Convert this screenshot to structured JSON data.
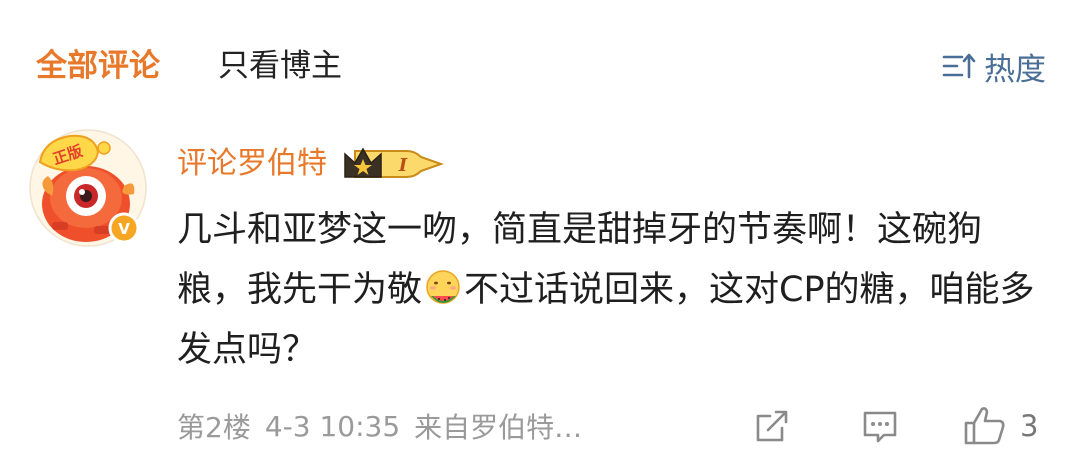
{
  "tabs": {
    "all_comments": "全部评论",
    "only_blogger": "只看博主"
  },
  "sort": {
    "label": "热度",
    "icon": "sort-icon"
  },
  "comment": {
    "author": "评论罗伯特",
    "badge": {
      "level": "I",
      "icon": "crown-icon"
    },
    "avatar": {
      "verified_mark": "V",
      "sticker_text": "正版"
    },
    "text_parts": [
      "几斗和亚梦这一吻，简直是甜掉牙的节奏啊！这碗狗粮，我先干为敬",
      "不过话说回来，这对CP的糖，咱能多发点吗？"
    ],
    "emoji": "eating-watermelon-emoji",
    "floor": "第2楼",
    "time": "4-3 10:35",
    "source": "来自罗伯特…",
    "likes": "3"
  },
  "colors": {
    "accent": "#e8792b",
    "link": "#4a6f96",
    "meta": "#9a9a9a"
  }
}
